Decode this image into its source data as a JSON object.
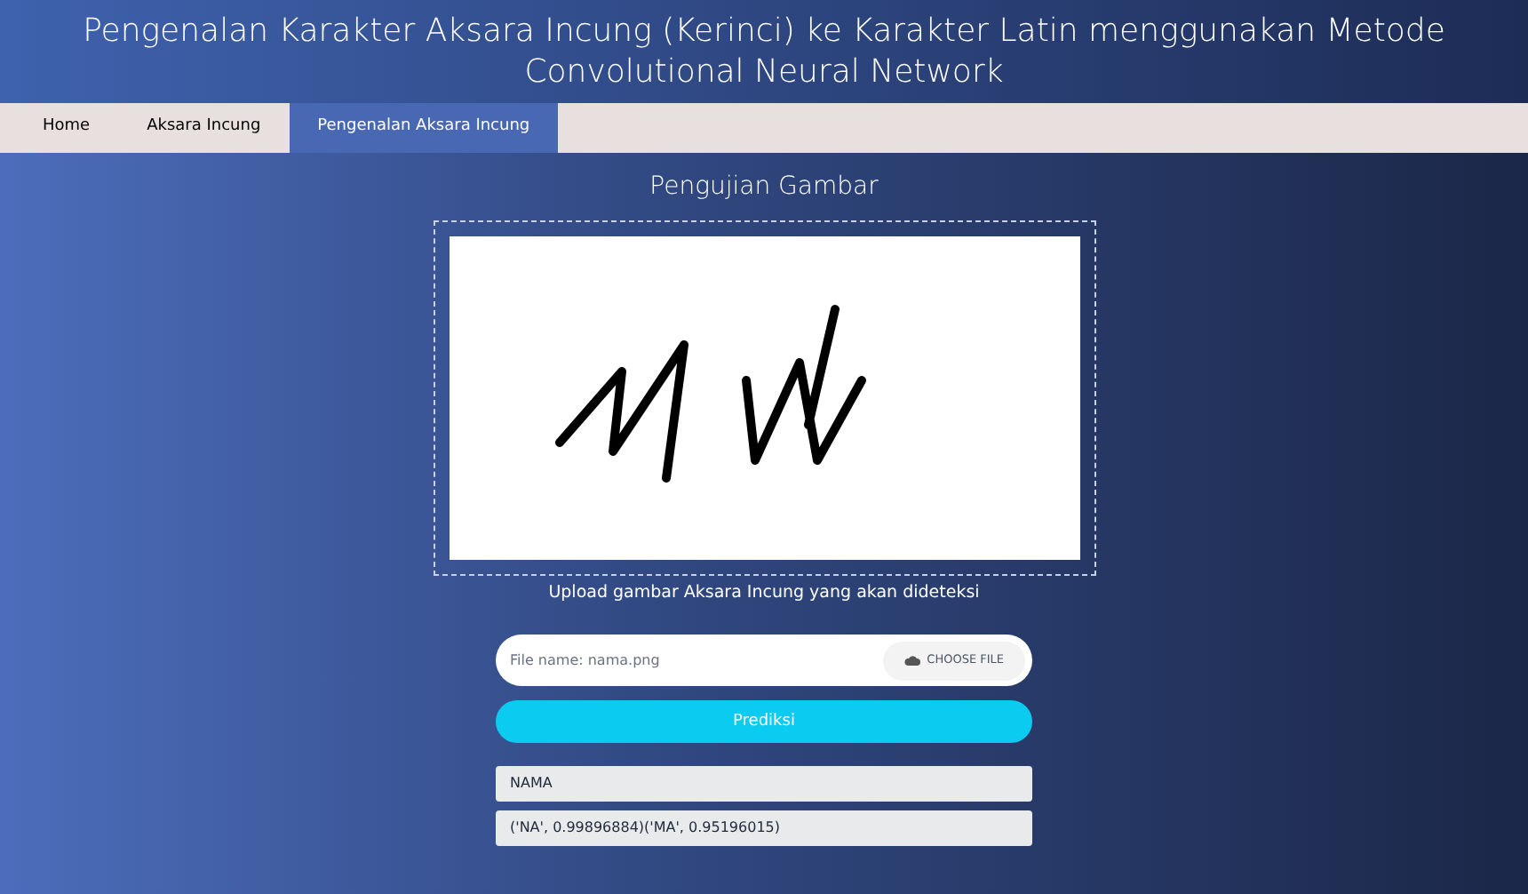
{
  "header": {
    "title": "Pengenalan Karakter Aksara Incung (Kerinci) ke Karakter Latin menggunakan Metode Convolutional Neural Network"
  },
  "nav": [
    {
      "label": "Home",
      "selected": false
    },
    {
      "label": "Aksara Incung",
      "selected": false
    },
    {
      "label": "Pengenalan Aksara Incung",
      "selected": true
    }
  ],
  "main": {
    "heading": "Pengujian Gambar",
    "upload_caption": "Upload gambar Aksara Incung yang akan dideteksi",
    "file_field": {
      "value": "File name: nama.png",
      "button": "CHOOSE FILE"
    },
    "predict_button": "Prediksi",
    "outputs": [
      "NAMA",
      "('NA', 0.99896884)('MA', 0.95196015)"
    ]
  }
}
